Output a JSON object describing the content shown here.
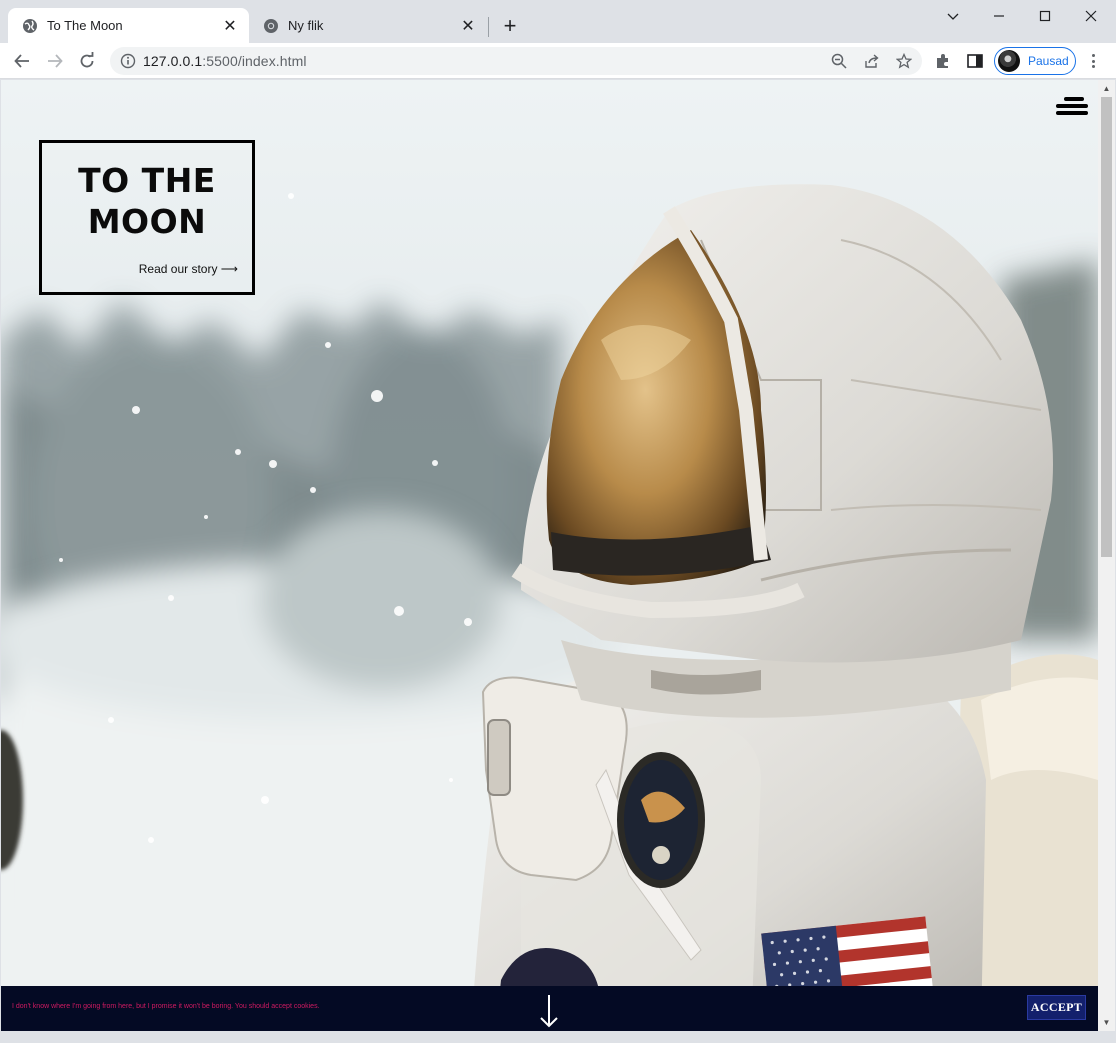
{
  "browser": {
    "tabs": [
      {
        "title": "To The Moon",
        "active": true,
        "icon": "globe-icon"
      },
      {
        "title": "Ny flik",
        "active": false,
        "icon": "chrome-icon"
      }
    ],
    "new_tab_label": "+",
    "url_host": "127.0.0.1",
    "url_rest": ":5500/index.html",
    "profile_name": "Pausad",
    "accent_color": "#1a73e8"
  },
  "page": {
    "heading": "TO THE\nMOON",
    "story_link": "Read our story ⟶",
    "menu_icon": "hamburger-icon",
    "hero_image": "astronaut-in-snowy-forest",
    "cookie": {
      "message": "I don't know where I'm going from here, but I promise it won't be boring. You should accept cookies.",
      "accept_label": "ACCEPT",
      "message_color": "#d01a61",
      "bar_color": "#040a24"
    }
  }
}
